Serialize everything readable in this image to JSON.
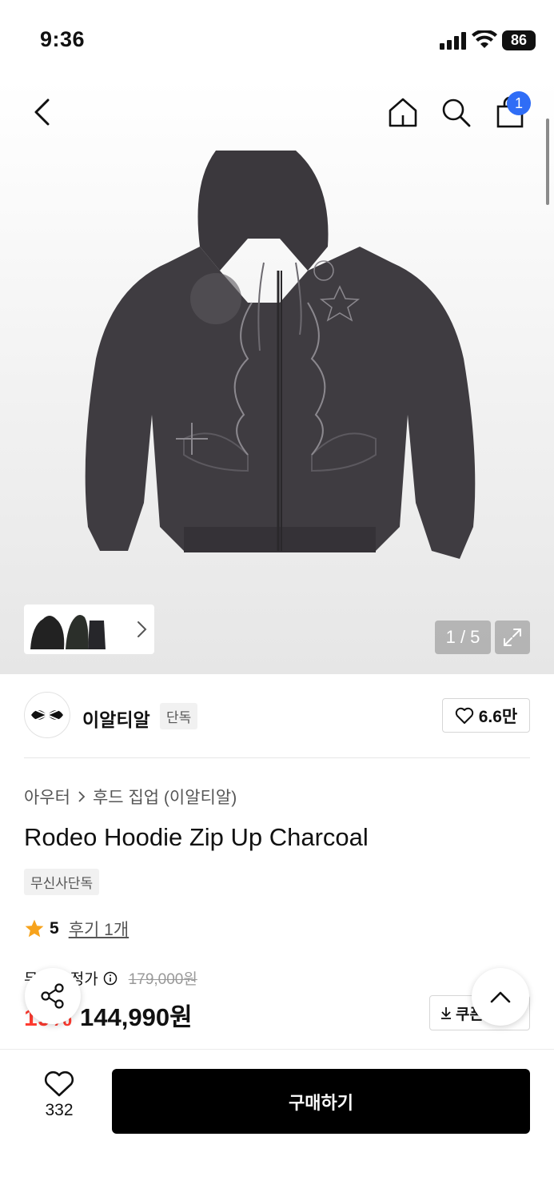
{
  "status_bar": {
    "time": "9:36",
    "battery": "86"
  },
  "header": {
    "cart_count": "1"
  },
  "gallery": {
    "counter": "1 / 5"
  },
  "brand": {
    "name": "이알티알",
    "tag": "단독",
    "likes": "6.6만"
  },
  "breadcrumb": {
    "category": "아우터",
    "subcategory": "후드 집업 (이알티알)"
  },
  "product": {
    "title": "Rodeo Hoodie Zip Up Charcoal",
    "tag": "무신사단독",
    "rating": "5",
    "reviews": "후기 1개"
  },
  "price": {
    "label": "무신사 정가",
    "original": "179,000원",
    "discount": "19%",
    "final": "144,990원",
    "coupon_label": "쿠폰"
  },
  "bottom": {
    "wish_count": "332",
    "buy_label": "구매하기"
  },
  "colors": {
    "accent": "#2f6df6",
    "discount": "#ff3b30",
    "buy": "#000000"
  }
}
